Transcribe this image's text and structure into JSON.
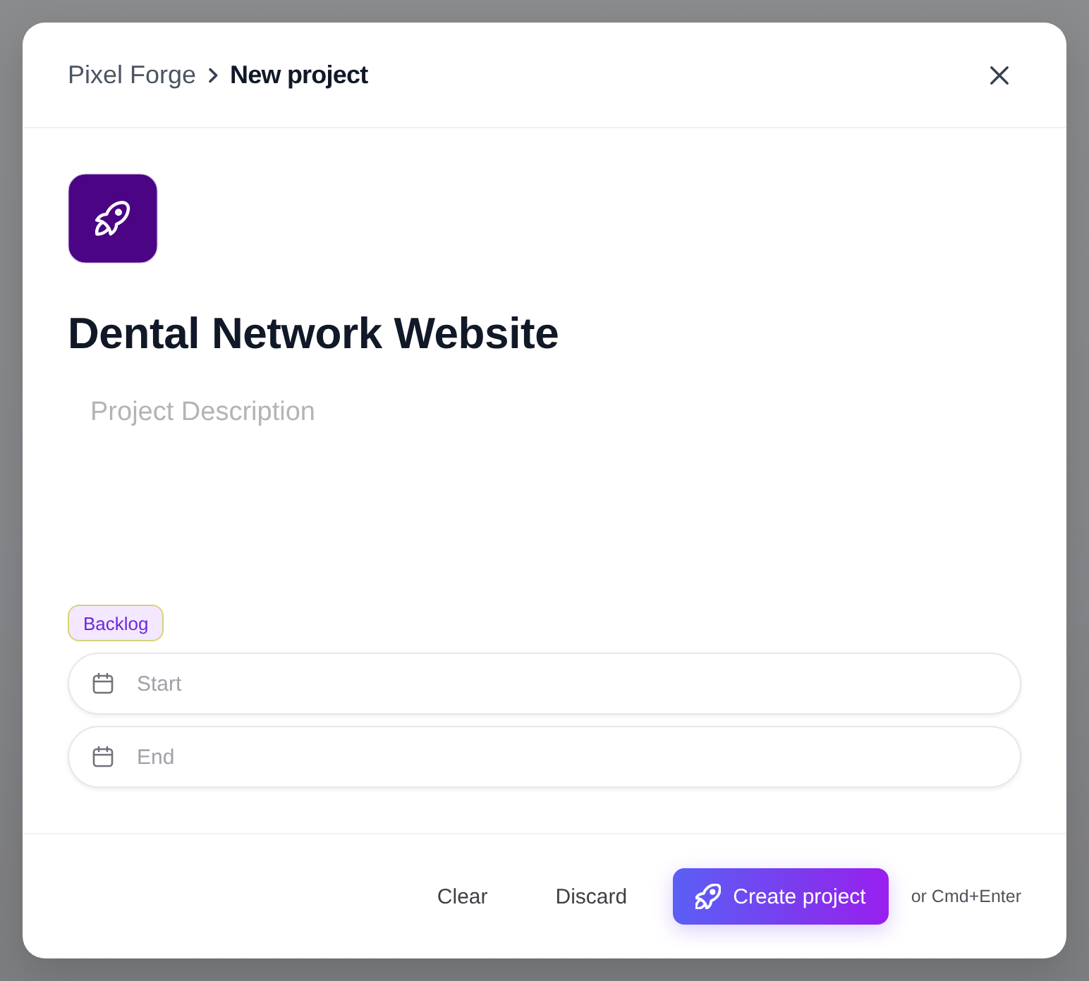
{
  "header": {
    "breadcrumb": [
      {
        "label": "Pixel Forge",
        "current": false
      },
      {
        "label": "New project",
        "current": true
      }
    ]
  },
  "project": {
    "title": "Dental Network Website",
    "description": {
      "placeholder": "Project Description"
    },
    "status": {
      "label": "Backlog"
    },
    "dates": [
      {
        "placeholder": "Start"
      },
      {
        "placeholder": "End"
      }
    ]
  },
  "footer": {
    "buttons": [
      {
        "label": "Clear",
        "kind": "ghost"
      },
      {
        "label": "Discard",
        "kind": "ghost"
      },
      {
        "label": "Create project",
        "kind": "primary"
      }
    ],
    "hint": "or Cmd+Enter"
  }
}
